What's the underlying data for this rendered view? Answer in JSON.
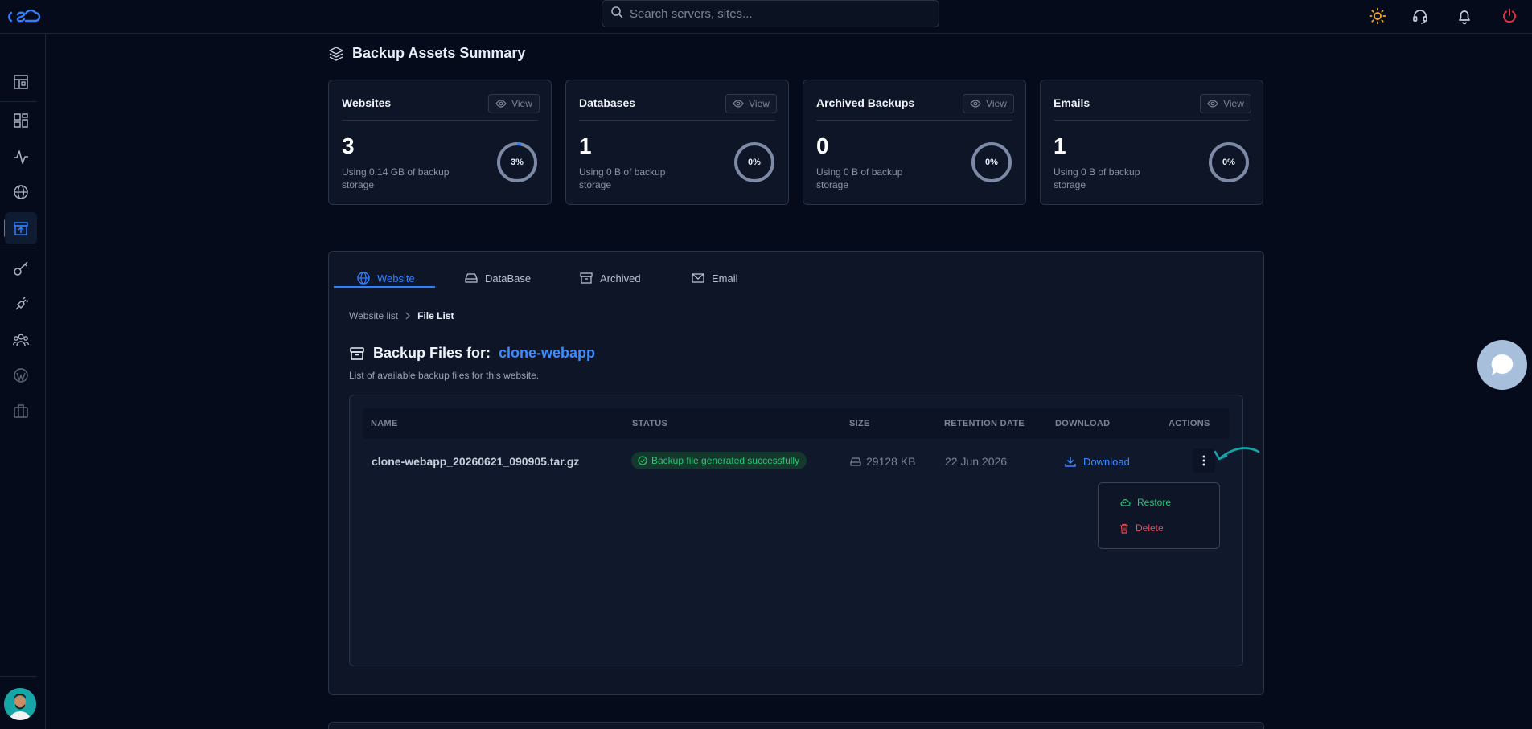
{
  "search": {
    "placeholder": "Search servers, sites..."
  },
  "summary": {
    "title": "Backup Assets Summary",
    "cards": [
      {
        "title": "Websites",
        "view_label": "View",
        "count": "3",
        "usage": "Using 0.14 GB of backup storage",
        "percent_label": "3%",
        "percent": 3
      },
      {
        "title": "Databases",
        "view_label": "View",
        "count": "1",
        "usage": "Using 0 B of backup storage",
        "percent_label": "0%",
        "percent": 0
      },
      {
        "title": "Archived Backups",
        "view_label": "View",
        "count": "0",
        "usage": "Using 0 B of backup storage",
        "percent_label": "0%",
        "percent": 0
      },
      {
        "title": "Emails",
        "view_label": "View",
        "count": "1",
        "usage": "Using 0 B of backup storage",
        "percent_label": "0%",
        "percent": 0
      }
    ]
  },
  "tabs": [
    {
      "label": "Website",
      "icon": "globe-icon",
      "active": true
    },
    {
      "label": "DataBase",
      "icon": "database-icon",
      "active": false
    },
    {
      "label": "Archived",
      "icon": "archive-icon",
      "active": false
    },
    {
      "label": "Email",
      "icon": "mail-icon",
      "active": false
    }
  ],
  "breadcrumb": {
    "parent": "Website list",
    "current": "File List"
  },
  "files": {
    "title": "Backup Files for:",
    "site": "clone-webapp",
    "subtitle": "List of available backup files for this website.",
    "columns": [
      "NAME",
      "STATUS",
      "SIZE",
      "RETENTION DATE",
      "DOWNLOAD",
      "ACTIONS"
    ],
    "rows": [
      {
        "name": "clone-webapp_20260621_090905.tar.gz",
        "status": "Backup file generated successfully",
        "size": "29128 KB",
        "retention": "22 Jun 2026",
        "download": "Download"
      }
    ]
  },
  "actions_menu": {
    "restore": "Restore",
    "delete": "Delete"
  },
  "colors": {
    "accent": "#2f80ff",
    "success": "#29c776",
    "danger": "#e44b55",
    "background": "#050b1a",
    "card": "#0d1526"
  }
}
